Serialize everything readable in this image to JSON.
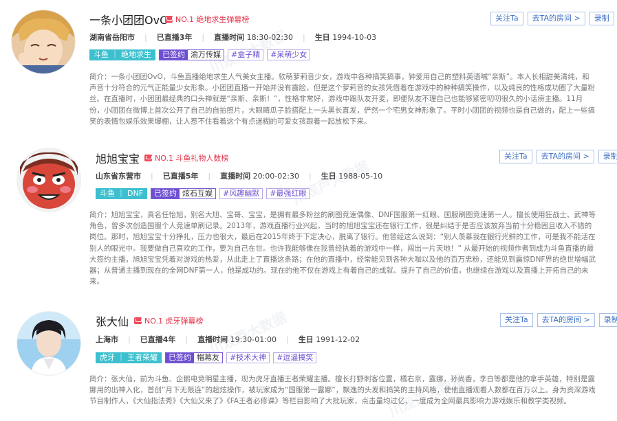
{
  "watermark": "川观芦大数据",
  "streamers": [
    {
      "name": "一条小团团OvO",
      "rank": "NO.1 绝地求生弹幕榜",
      "buttons": {
        "follow": "关注Ta",
        "room": "去TA的房间 >",
        "record": "录制"
      },
      "location": "湖南省岳阳市",
      "years": "已直播3年",
      "time_label": "直播时间",
      "time_value": "18:30-02:30",
      "birthday_label": "生日",
      "birthday_value": "1994-10-03",
      "platform_tag": "斗鱼 ｜ 绝地求生",
      "sign_label": "已签约",
      "sign_value": "渝万传媒",
      "hash_tags": [
        "#盒子精",
        "#呆萌少女"
      ],
      "desc": "简介：一条小团团OvO，斗鱼直播绝地求生人气美女主播。软萌萝莉音少女，游戏中各种搞笑搞事，钟爱用自己的塑料英语喊“亲斯”。本人长相甜美清纯，和声音十分符合的元气正能量少女形象。小团团直播一开始并没有露脸，但是这个萝莉音的女孩凭借着在游戏中的种种搞笑操作，以及纯良的性格成功圈了大量粉丝。在直播时，小团团最经典的口头禅就是“亲斯、亲斯！”，性格非常好，游戏中跟队友开麦，即便队友不理自己也能够紧密叨叨很久的小话痨主播。11月份，小团团在微博上首次公开了自己的自拍照片，大眼睛瓜子脸搭配上一头黑长直发，俨然一个宅男女神形象了。平时小团团的视频也是自己做的，配上一些搞笑的表情包娱乐效果爆棚，让人惹不住看着这个有点迷糊的可爱女孩跟着一起放松下来。"
    },
    {
      "name": "旭旭宝宝",
      "rank": "NO.1 斗鱼礼物人数榜",
      "buttons": {
        "follow": "关注Ta",
        "room": "去TA的房间 >",
        "record": "录制"
      },
      "location": "山东省东营市",
      "years": "已直播5年",
      "time_label": "直播时间",
      "time_value": "20:00-02:30",
      "birthday_label": "生日",
      "birthday_value": "1988-05-10",
      "platform_tag": "斗鱼 ｜ DNF",
      "sign_label": "已签约",
      "sign_value": "炫石互娱",
      "hash_tags": [
        "#风趣幽默",
        "#最强红眼"
      ],
      "desc": "简介：旭旭宝宝，真名任怡旭，别名大旭、宝哥、宝宝，是拥有最多粉丝的刷图竞速偶像、DNF国服第一红眼、国服刷图竞速第一人。擅长使用狂战士、武神等角色，曾多次创造国服个人竞速单刷记录。2013年，游戏直播行业兴起，当时的旭旭宝宝还在银行工作，很是纠结于是否应该放弃当前十分稳固且收入不错的岗位。那时，旭旭宝宝十分挣扎，压力也很大，最后在2015年终于下定决心，脱离了银行。他曾经这么说到：“别人羡慕我在银行光鲜的工作，可是我不能活在别人的眼光中。我要做自己喜欢的工作，要为自己在世。也许我能够像在我曾经执着的游戏中一样，闯出一片天地！” 从最开始的视频作者到成为斗鱼直播的最大签约主播，旭旭宝宝凭着对游戏的热爱，从此走上了直播这条路；在他的直播中，经常能见到各种大咖以及他的百万忠粉，还能见到震惊DNF界的绝世增幅武器；从普通主播到现在的全网DNF第一人，他是成功的。现在的他不仅在游戏上有着自己的成就、提升了自己的价值，也继续在游戏以及直播上开拓自己的未来。"
    },
    {
      "name": "张大仙",
      "rank": "NO.1 虎牙弹幕榜",
      "buttons": {
        "follow": "关注Ta",
        "room": "去TA的房间 >",
        "record": "录制"
      },
      "location": "上海市",
      "years": "已直播4年",
      "time_label": "直播时间",
      "time_value": "19:30-01:00",
      "birthday_label": "生日",
      "birthday_value": "1991-12-02",
      "platform_tag": "虎牙 ｜ 王者荣耀",
      "sign_label": "已签约",
      "sign_value": "帽幕友",
      "hash_tags": [
        "#技术大神",
        "#逗逼搞笑"
      ],
      "desc": "简介：张大仙，前为斗鱼、企鹅电竞明星主播，现为虎牙直播王者荣耀主播。擅长打野刺客位置，橘右京，露娜，孙尚香，李白等都是他的拿手英雄，特别是露娜用的出神入化，首创“月下无限连”的超炫操作，被玩家成为“国服第一露娜”，飘逸的头发和搞笑的主持风格，使他直播观看人数都在百万以上。身为资深游戏节目制作人，《大仙指法秀》《大仙又来了》《FA王者必修课》等栏目影响了大批玩家，点击量均过亿，一度成为全网最具影响力游戏娱乐和教学类视频。"
    }
  ],
  "colors": {
    "rank": "#e5344a",
    "button": "#3c6fc4",
    "platform": "#3cc0cf",
    "sign": "#6e4fd1"
  }
}
